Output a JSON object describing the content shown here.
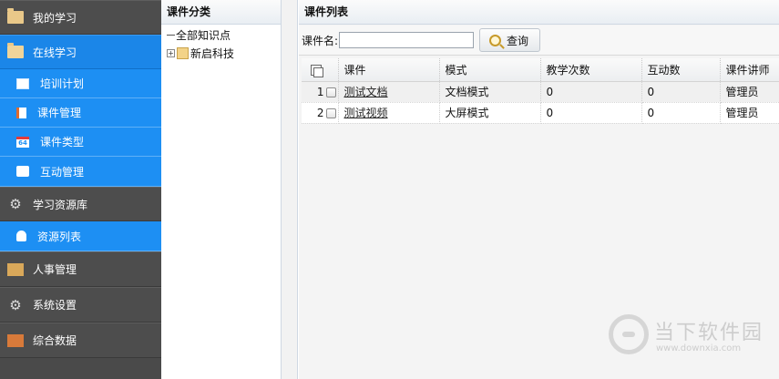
{
  "sidebar": {
    "sections": [
      {
        "label": "我的学习",
        "icon": "folder-icon"
      },
      {
        "label": "在线学习",
        "icon": "open-folder-icon",
        "active": true
      },
      {
        "label": "学习资源库",
        "icon": "gear-icon"
      },
      {
        "label": "人事管理",
        "icon": "person-card-icon"
      },
      {
        "label": "系统设置",
        "icon": "gear-icon"
      },
      {
        "label": "综合数据",
        "icon": "box-icon"
      }
    ],
    "online_items": [
      {
        "label": "培训计划",
        "icon": "screen-icon"
      },
      {
        "label": "课件管理",
        "icon": "document-icon"
      },
      {
        "label": "课件类型",
        "icon": "calendar-icon",
        "badge": "64"
      },
      {
        "label": "互动管理",
        "icon": "chat-icon"
      }
    ],
    "resource_items": [
      {
        "label": "资源列表",
        "icon": "disk-icon"
      }
    ],
    "colors": {
      "active": "#1b86e8",
      "sub": "#1d8ff3",
      "base": "#4d4d4d"
    }
  },
  "category_panel": {
    "title": "课件分类",
    "tree": [
      {
        "label": "全部知识点"
      },
      {
        "label": "新启科技",
        "expander": "+"
      }
    ]
  },
  "list_panel": {
    "title": "课件列表",
    "search": {
      "label": "课件名:",
      "value": "",
      "placeholder": "",
      "button": "查询"
    },
    "columns": [
      "课件",
      "模式",
      "教学次数",
      "互动数",
      "课件讲师"
    ],
    "rows": [
      {
        "num": "1",
        "name": "测试文档",
        "mode": "文档模式",
        "teach_count": "0",
        "interact_count": "0",
        "teacher": "管理员"
      },
      {
        "num": "2",
        "name": "测试视频",
        "mode": "大屏模式",
        "teach_count": "0",
        "interact_count": "0",
        "teacher": "管理员"
      }
    ]
  },
  "watermark": {
    "title": "当下软件园",
    "url": "www.downxia.com"
  }
}
